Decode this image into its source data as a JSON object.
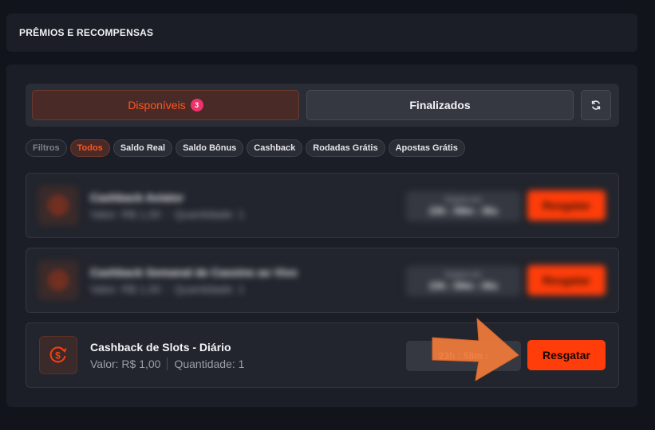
{
  "header": {
    "title": "PRÊMIOS E RECOMPENSAS"
  },
  "tabs": {
    "available_label": "Disponíveis",
    "available_count": "3",
    "finished_label": "Finalizados"
  },
  "filters": {
    "label": "Filtros",
    "items": [
      "Todos",
      "Saldo Real",
      "Saldo Bônus",
      "Cashback",
      "Rodadas Grátis",
      "Apostas Grátis"
    ],
    "active": "Todos"
  },
  "rewards": [
    {
      "title": "Cashback Aviator",
      "value": "Valor: R$ 1,00",
      "quantity": "Quantidade: 1",
      "expire_label": "Expira em",
      "expire_time": "23h : 59m : 35s",
      "claim_label": "Resgatar"
    },
    {
      "title": "Cashback Semanal de Cassino ao Vivo",
      "value": "Valor: R$ 1,00",
      "quantity": "Quantidade: 1",
      "expire_label": "Expira em",
      "expire_time": "23h : 59m : 06s",
      "claim_label": "Resgatar"
    },
    {
      "title": "Cashback de Slots - Diário",
      "value": "Valor: R$ 1,00",
      "quantity": "Quantidade: 1",
      "expire_label": "",
      "expire_time": "23h : 58m :",
      "claim_label": "Resgatar"
    }
  ],
  "colors": {
    "accent": "#ff3d0a",
    "badge": "#f0326c",
    "background": "#12141b",
    "panel": "#1b1e26"
  },
  "icons": {
    "refresh": "refresh-icon",
    "reward": "cashback-coin-icon",
    "arrow": "orange-arrow-annotation"
  }
}
